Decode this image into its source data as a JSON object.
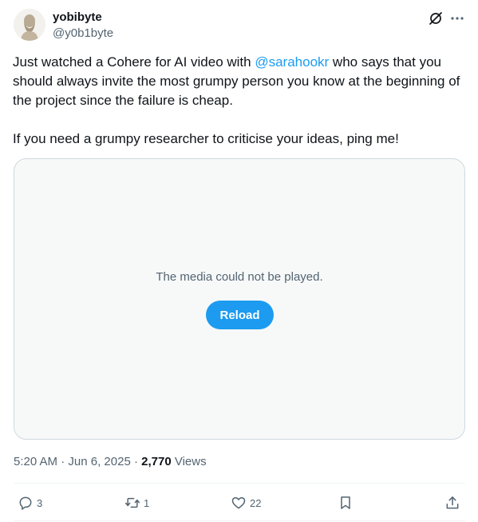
{
  "author": {
    "name": "yobibyte",
    "handle": "@y0b1byte"
  },
  "tweet": {
    "p1_before": "Just watched a Cohere for AI video with ",
    "mention": "@sarahookr",
    "p1_after": " who says that you should always invite the most grumpy person you know at the beginning of the project since the failure is cheap.",
    "p2": "If you need a grumpy researcher to criticise your ideas, ping me!"
  },
  "media": {
    "message": "The media could not be played.",
    "reload_label": "Reload"
  },
  "meta": {
    "time": "5:20 AM",
    "date": "Jun 6, 2025",
    "views_count": "2,770",
    "views_label": "Views"
  },
  "actions": {
    "replies": "3",
    "reposts": "1",
    "likes": "22"
  },
  "colors": {
    "accent": "#1d9bf0",
    "secondary_text": "#536471",
    "primary_text": "#0f1419"
  }
}
